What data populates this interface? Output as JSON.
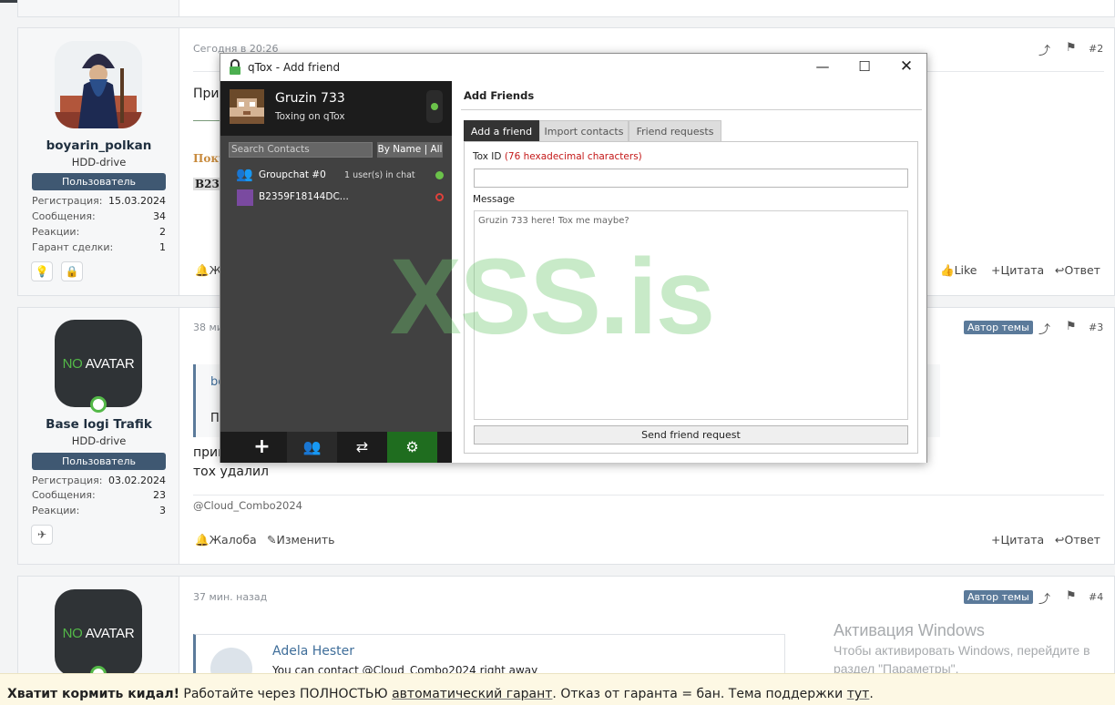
{
  "posts": [
    {
      "number": "#2",
      "time": "Сегодня в 20:26",
      "author": "boyarin_polkan",
      "user_title": "HDD-drive",
      "badge": "Пользователь",
      "stats": [
        {
          "label": "Регистрация:",
          "value": "15.03.2024"
        },
        {
          "label": "Сообщения:",
          "value": "34"
        },
        {
          "label": "Реакции:",
          "value": "2"
        },
        {
          "label": "Гарант сделки:",
          "value": "1"
        }
      ],
      "text_start": "При",
      "bold_fragment": "Поку",
      "bold_fragment2": "B235",
      "actions": {
        "report": "Жа",
        "like": "Like",
        "quote": "Цитата",
        "reply": "Ответ"
      }
    },
    {
      "number": "#3",
      "time": "38 ми",
      "author_tag": "Автор темы",
      "author": "Base logi Trafik",
      "avatar_text_no": "NO",
      "avatar_text_rest": " AVATAR",
      "user_title": "HDD-drive",
      "badge": "Пользователь",
      "stats": [
        {
          "label": "Регистрация:",
          "value": "03.02.2024"
        },
        {
          "label": "Сообщения:",
          "value": "23"
        },
        {
          "label": "Реакции:",
          "value": "3"
        }
      ],
      "quote_author": "bo",
      "quote_text": "Пр",
      "line1": "прив",
      "line2": "тох удалил",
      "signature": "@Cloud_Combo2024",
      "actions": {
        "report": "Жалоба",
        "edit": "Изменить",
        "quote": "Цитата",
        "reply": "Ответ"
      }
    },
    {
      "number": "#4",
      "time": "37 мин. назад",
      "author_tag": "Автор темы",
      "avatar_text_no": "NO",
      "avatar_text_rest": " AVATAR",
      "quote_author": "Adela Hester",
      "quote_text": "You can contact @Cloud_Combo2024 right away"
    }
  ],
  "qtox": {
    "window_title": "qTox - Add friend",
    "profile": {
      "name": "Gruzin 733",
      "status": "Toxing on qTox"
    },
    "search_placeholder": "Search Contacts",
    "sort_label": "By Name | All",
    "contacts": [
      {
        "name": "Groupchat #0",
        "extra": "1 user(s) in chat",
        "status_color": "#6bc24a"
      },
      {
        "name": "B2359F18144DC...",
        "extra": "",
        "status_color": "#e0413b"
      }
    ],
    "section_title": "Add Friends",
    "tabs": [
      "Add a friend",
      "Import contacts",
      "Friend requests"
    ],
    "tox_id_label": "Tox ID",
    "tox_id_hint": "(76 hexadecimal characters)",
    "tox_id_value": "",
    "message_label": "Message",
    "message_value": "Gruzin 733 here! Tox me maybe?",
    "send_button": "Send friend request",
    "accent_green": "#1f6d1f"
  },
  "watermark": "XSS.is",
  "windows_activation": {
    "title": "Активация Windows",
    "line1": "Чтобы активировать Windows, перейдите в",
    "line2": "раздел \"Параметры\"."
  },
  "footer": {
    "bold": "Хватит кормить кидал!",
    "text1": " Работайте через ПОЛНОСТЬЮ ",
    "link1": "автоматический гарант",
    "text2": ". Отказ от гаранта = бан. Тема поддержки ",
    "link2": "тут",
    "text3": "."
  }
}
